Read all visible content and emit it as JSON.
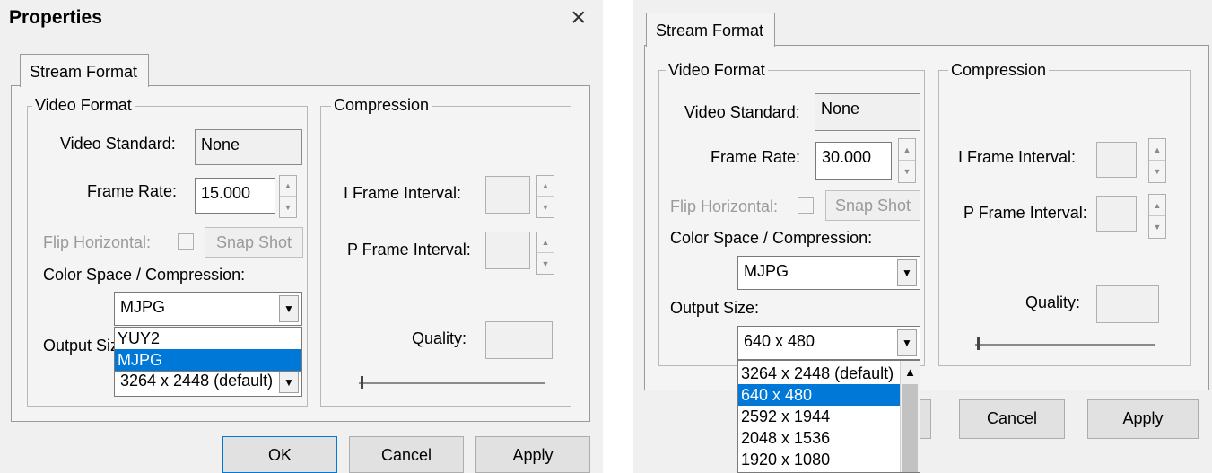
{
  "left": {
    "window_title": "Properties",
    "close_glyph": "×",
    "tab_label": "Stream Format",
    "video_format": {
      "legend": "Video Format",
      "video_standard_label": "Video Standard:",
      "video_standard_value": "None",
      "frame_rate_label": "Frame Rate:",
      "frame_rate_value": "15.000",
      "flip_horizontal_label": "Flip Horizontal:",
      "snap_shot_label": "Snap Shot",
      "color_space_label": "Color Space / Compression:",
      "color_space_value": "MJPG",
      "color_space_options": [
        "YUY2",
        "MJPG"
      ],
      "color_space_selected_index": 1,
      "output_size_label": "Output Size:",
      "output_size_value": "3264 x 2448  (default)"
    },
    "compression": {
      "legend": "Compression",
      "i_frame_label": "I Frame Interval:",
      "p_frame_label": "P Frame Interval:",
      "quality_label": "Quality:"
    },
    "buttons": {
      "ok": "OK",
      "cancel": "Cancel",
      "apply": "Apply"
    }
  },
  "right": {
    "tab_label": "Stream Format",
    "video_format": {
      "legend": "Video Format",
      "video_standard_label": "Video Standard:",
      "video_standard_value": "None",
      "frame_rate_label": "Frame Rate:",
      "frame_rate_value": "30.000",
      "flip_horizontal_label": "Flip Horizontal:",
      "snap_shot_label": "Snap Shot",
      "color_space_label": "Color Space / Compression:",
      "color_space_value": "MJPG",
      "output_size_label": "Output Size:",
      "output_size_value": "640 x 480",
      "output_size_options": [
        "3264 x 2448  (default)",
        "640 x 480",
        "2592 x 1944",
        "2048 x 1536",
        "1920 x 1080"
      ],
      "output_size_selected_index": 1
    },
    "compression": {
      "legend": "Compression",
      "i_frame_label": "I Frame Interval:",
      "p_frame_label": "P Frame Interval:",
      "quality_label": "Quality:"
    },
    "buttons": {
      "cancel": "Cancel",
      "apply": "Apply"
    }
  },
  "icons": {
    "spin_up": "▲",
    "spin_down": "▼",
    "dropdown_arrow": "▼",
    "scroll_up": "▲"
  },
  "colors": {
    "dialog_bg": "#f0f0f0",
    "selection": "#0078d7",
    "default_button_border": "#0078d7"
  }
}
